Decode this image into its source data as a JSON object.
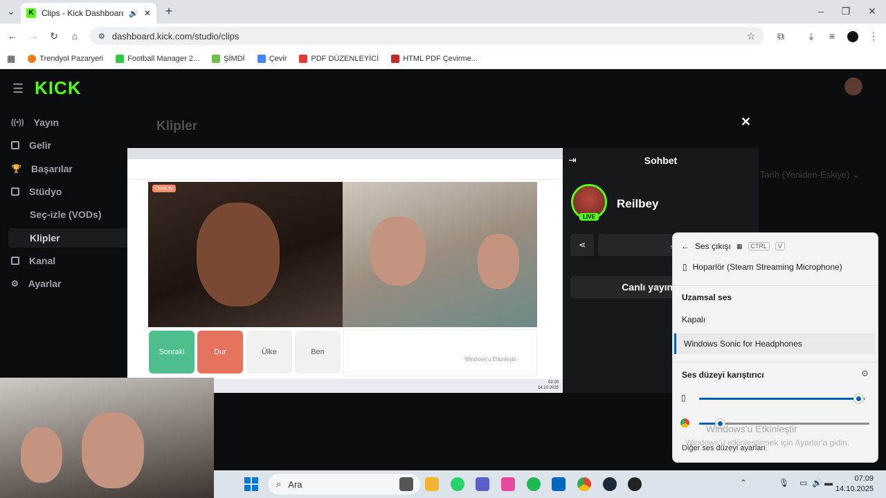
{
  "browser": {
    "tab_title": "Clips - Kick Dashboard",
    "url": "dashboard.kick.com/studio/clips",
    "bookmarks": [
      "Trendyol Pazaryeri",
      "Football Manager 2...",
      "ŞİMDİ",
      "Çevir",
      "PDF DÜZENLEYİCİ",
      "HTML PDF Çevirme..."
    ]
  },
  "app": {
    "logo": "KICK",
    "nav": [
      "Yayın",
      "Gelir",
      "Başarılar",
      "Stüdyo",
      "Seç-izle (VODs)",
      "Klipler",
      "Kanal",
      "Ayarlar"
    ],
    "page_title": "Klipler",
    "sort_label": "Tarih (Yeniden-Eskiye)"
  },
  "video": {
    "buttons": [
      "Sonraki",
      "Dur",
      "Ülke",
      "Ben"
    ],
    "watermark": "Windows'u Etkinleştir",
    "omegle_logo": "Ome.tv",
    "clock_time": "03:29",
    "clock_date": "14.10.2025"
  },
  "chat": {
    "title": "Sohbet",
    "username": "Reilbey",
    "live_badge": "LIVE",
    "live_button": "Canlı yayını"
  },
  "flyout": {
    "title": "Ses çıkışı",
    "kbd": [
      "CTRL",
      "V"
    ],
    "device": "Hoparlör (Steam Streaming Microphone)",
    "spatial_header": "Uzamsal ses",
    "spatial_off": "Kapalı",
    "spatial_sonic": "Windows Sonic for Headphones",
    "mixer_header": "Ses düzeyi karıştırıcı",
    "system_volume": 0.96,
    "chrome_volume": 0.12,
    "more_settings": "Diğer ses düzeyi ayarları"
  },
  "activation": {
    "title": "Windows'u Etkinleştir",
    "subtitle": "Windows'u etkinleştirmek için Ayarlar'a gidin."
  },
  "taskbar": {
    "search": "Ara",
    "time": "07:09",
    "date": "14.10.2025"
  }
}
